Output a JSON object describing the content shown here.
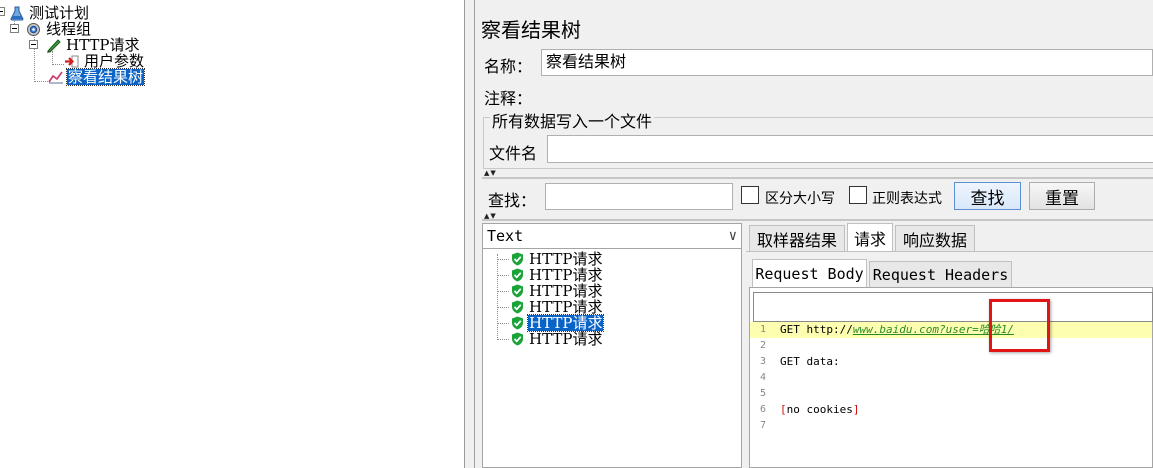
{
  "tree": {
    "nodes": [
      {
        "label": "测试计划",
        "icon": "flask-icon"
      },
      {
        "label": "线程组",
        "icon": "gear-icon"
      },
      {
        "label": "HTTP请求",
        "icon": "pen-icon"
      },
      {
        "label": "用户参数",
        "icon": "arrow-icon"
      },
      {
        "label": "察看结果树",
        "icon": "chart-icon",
        "selected": true
      }
    ]
  },
  "panel": {
    "title": "察看结果树",
    "name_label": "名称：",
    "name_value": "察看结果树",
    "comment_label": "注释：",
    "file_group_title": "所有数据写入一个文件",
    "file_label": "文件名",
    "file_value": ""
  },
  "search": {
    "label": "查找：",
    "value": "",
    "case_label": "区分大小写",
    "regex_label": "正则表达式",
    "find_button": "查找",
    "reset_button": "重置"
  },
  "results": {
    "renderer": "Text",
    "items": [
      {
        "label": "HTTP请求",
        "status": "success"
      },
      {
        "label": "HTTP请求",
        "status": "success"
      },
      {
        "label": "HTTP请求",
        "status": "success"
      },
      {
        "label": "HTTP请求",
        "status": "success"
      },
      {
        "label": "HTTP请求",
        "status": "success",
        "selected": true
      },
      {
        "label": "HTTP请求",
        "status": "success"
      }
    ]
  },
  "detail": {
    "tabs": [
      "取样器结果",
      "请求",
      "响应数据"
    ],
    "active_tab": "请求",
    "subtabs": [
      "Request Body",
      "Request Headers"
    ],
    "active_subtab": "Request Body",
    "code": {
      "line_numbers": [
        "1",
        "2",
        "3",
        "4",
        "5",
        "6",
        "7"
      ],
      "line1_method": "GET http://",
      "line1_url": "www.baidu.com?user",
      "line1_value": "=哈哈1/",
      "line3": "GET data:",
      "line6_open": "[",
      "line6_text": "no cookies",
      "line6_close": "]"
    }
  },
  "colors": {
    "selection": "#0a64c8",
    "highlight_line": "#fefeb0",
    "annotation": "#e01515",
    "success": "#1aa43a"
  }
}
